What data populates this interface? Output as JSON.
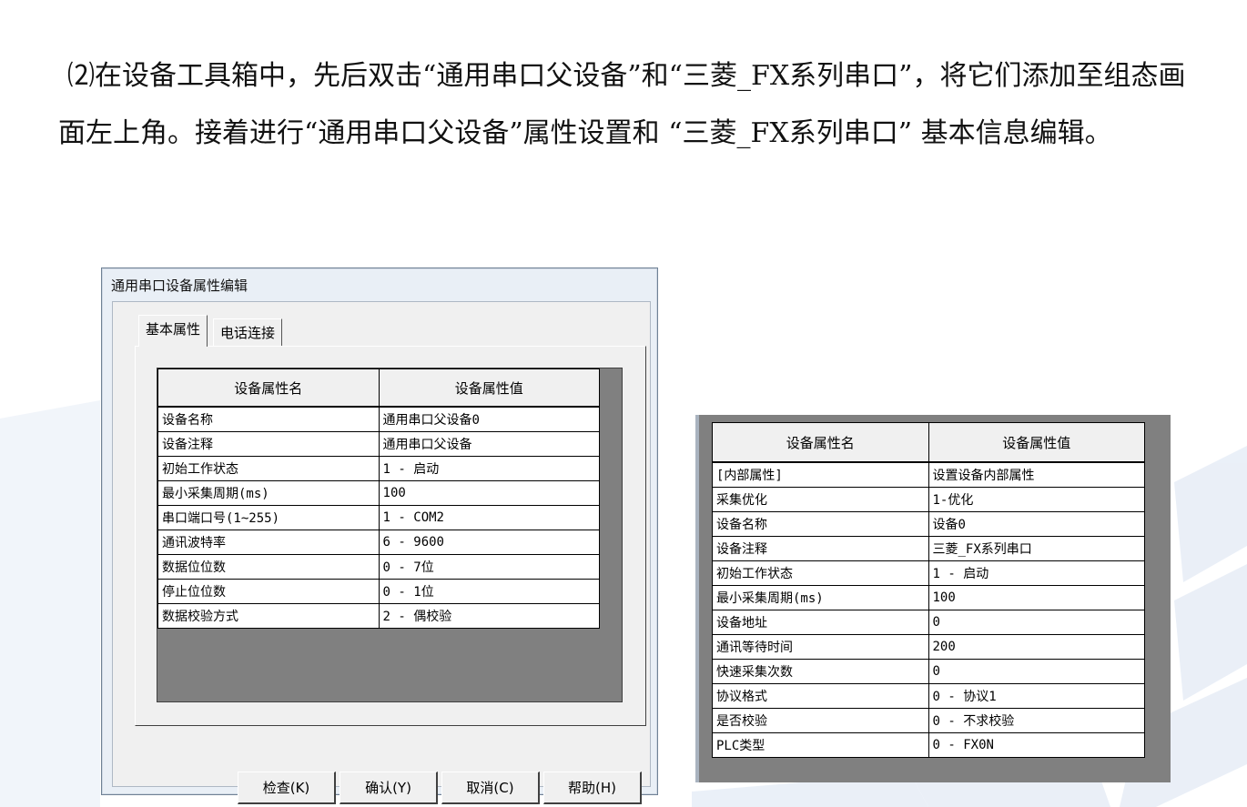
{
  "paragraph": {
    "text": "⑵在设备工具箱中，先后双击“通用串口父设备”和“三菱_FX系列串口”，将它们添加至组态画面左上角。接着进行“通用串口父设备”属性设置和 “三菱_FX系列串口” 基本信息编辑。"
  },
  "dialog": {
    "title": "通用串口设备属性编辑",
    "tabs": [
      {
        "label": "基本属性"
      },
      {
        "label": "电话连接"
      }
    ],
    "headers": {
      "name": "设备属性名",
      "value": "设备属性值"
    },
    "rows": [
      {
        "name": "设备名称",
        "value": "通用串口父设备0"
      },
      {
        "name": "设备注释",
        "value": "通用串口父设备"
      },
      {
        "name": "初始工作状态",
        "value": "1 - 启动"
      },
      {
        "name": "最小采集周期(ms)",
        "value": "100"
      },
      {
        "name": "串口端口号(1~255)",
        "value": "1 - COM2"
      },
      {
        "name": "通讯波特率",
        "value": "6 - 9600"
      },
      {
        "name": "数据位位数",
        "value": "0 - 7位"
      },
      {
        "name": "停止位位数",
        "value": "0 - 1位"
      },
      {
        "name": "数据校验方式",
        "value": "2 - 偶校验"
      }
    ],
    "buttons": {
      "check": "检查(K)",
      "confirm": "确认(Y)",
      "cancel": "取消(C)",
      "help": "帮助(H)"
    }
  },
  "panel2": {
    "headers": {
      "name": "设备属性名",
      "value": "设备属性值"
    },
    "rows": [
      {
        "name": "[内部属性]",
        "value": "设置设备内部属性"
      },
      {
        "name": "采集优化",
        "value": "1-优化"
      },
      {
        "name": "设备名称",
        "value": "设备0"
      },
      {
        "name": "设备注释",
        "value": "三菱_FX系列串口"
      },
      {
        "name": "初始工作状态",
        "value": "1 - 启动"
      },
      {
        "name": "最小采集周期(ms)",
        "value": "100"
      },
      {
        "name": "设备地址",
        "value": "0"
      },
      {
        "name": "通讯等待时间",
        "value": "200"
      },
      {
        "name": "快速采集次数",
        "value": "0"
      },
      {
        "name": "协议格式",
        "value": "0 - 协议1"
      },
      {
        "name": "是否校验",
        "value": "0 - 不求校验"
      },
      {
        "name": "PLC类型",
        "value": "0 - FX0N"
      }
    ]
  }
}
